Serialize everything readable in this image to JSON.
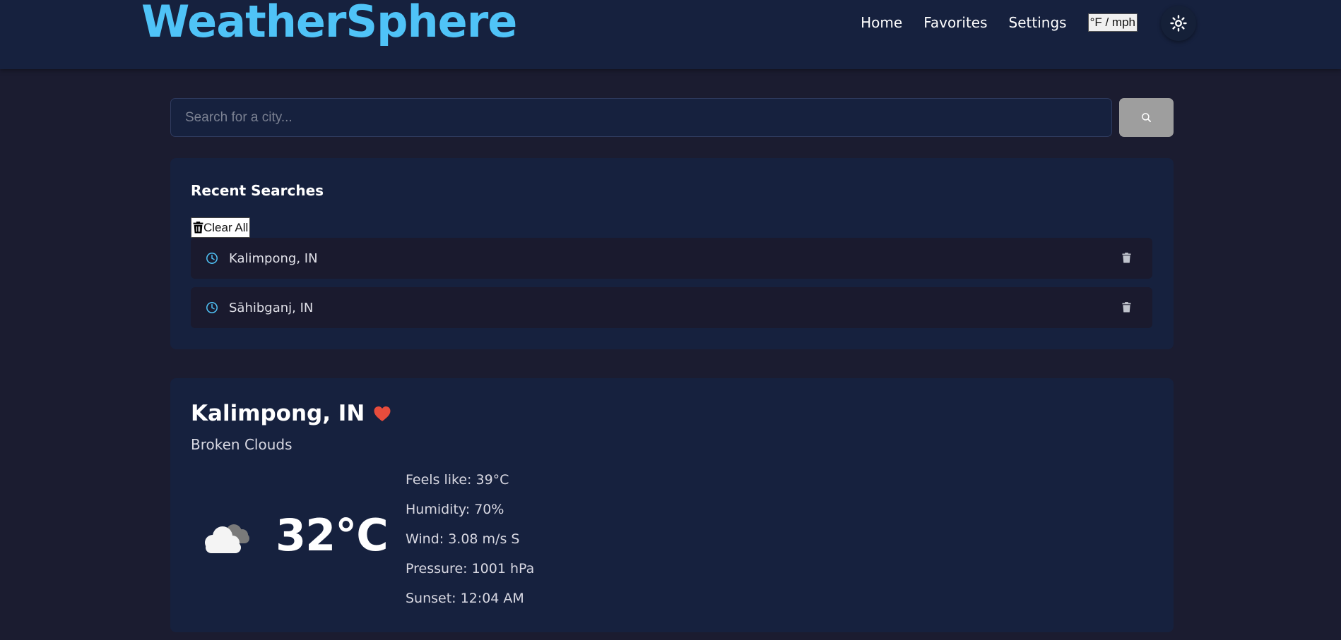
{
  "header": {
    "brand": "WeatherSphere",
    "nav": [
      "Home",
      "Favorites",
      "Settings"
    ],
    "unit_toggle": "°F / mph",
    "theme_icon": "sun-icon"
  },
  "search": {
    "placeholder": "Search for a city...",
    "value": "",
    "button_icon": "search-icon"
  },
  "recent": {
    "title": "Recent Searches",
    "clear_label": "Clear All",
    "items": [
      {
        "city": "Kalimpong, IN"
      },
      {
        "city": "Sāhibganj, IN"
      }
    ]
  },
  "weather": {
    "city": "Kalimpong, IN",
    "favorite": true,
    "description": "Broken Clouds",
    "icon": "broken-clouds-icon",
    "temperature": "32°C",
    "details": [
      "Feels like: 39°C",
      "Humidity: 70%",
      "Wind: 3.08 m/s S",
      "Pressure: 1001 hPa",
      "Sunset: 12:04 AM"
    ]
  },
  "colors": {
    "background": "#1b1c30",
    "panel": "#16213e",
    "accent": "#4fc3f7",
    "heart": "#e74c3c",
    "search_button": "#9e9e9e"
  }
}
